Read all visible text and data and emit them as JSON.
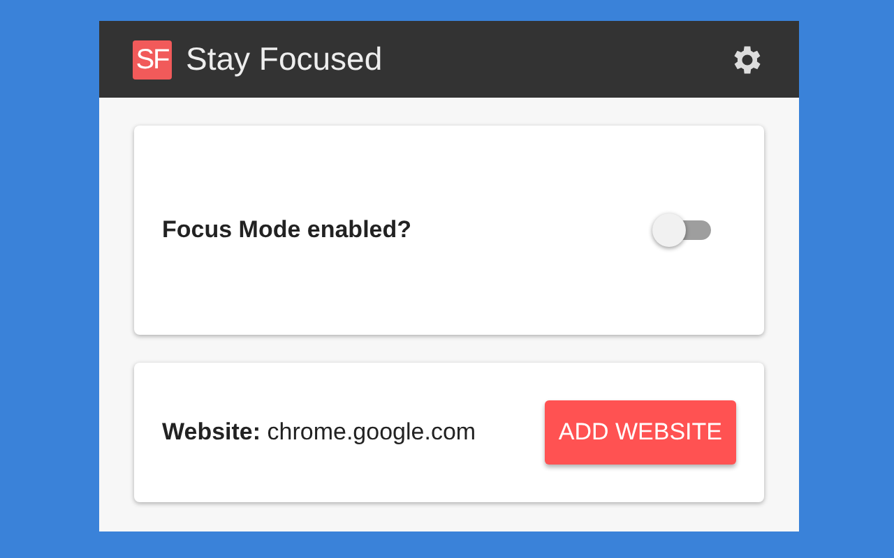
{
  "header": {
    "logo": "SF",
    "title": "Stay Focused"
  },
  "focus_mode": {
    "label": "Focus Mode enabled?",
    "on": false
  },
  "website": {
    "text": "**Website:** chrome.google.com",
    "button": "ADD WEBSITE"
  }
}
